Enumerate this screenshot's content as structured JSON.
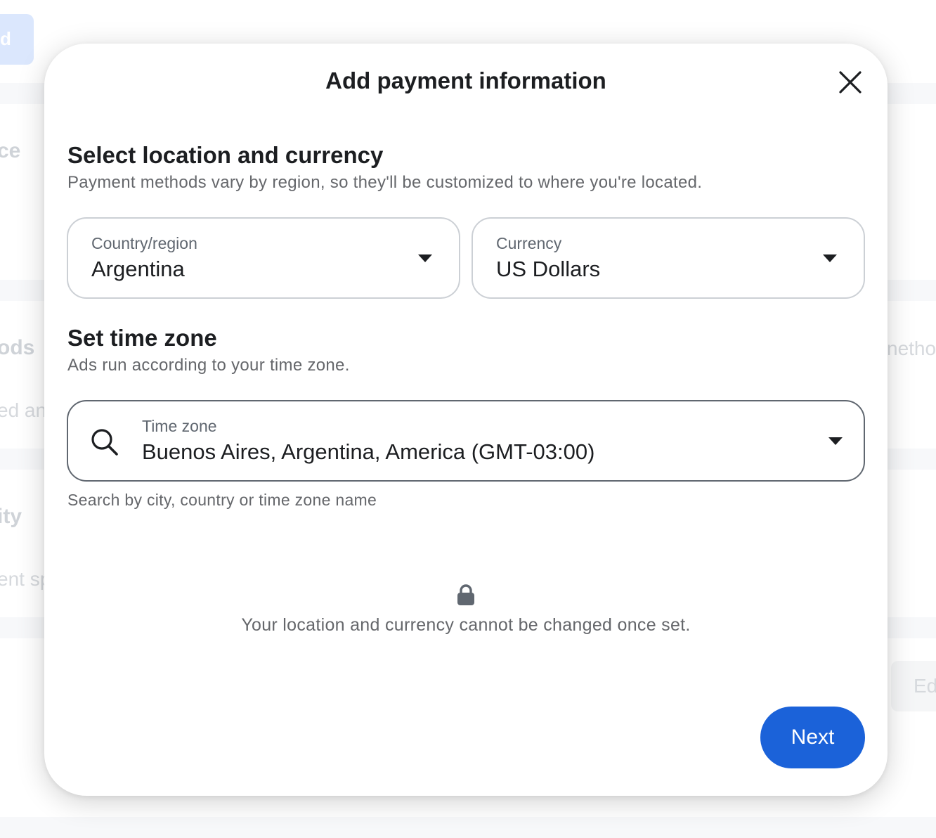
{
  "background": {
    "button_fragment": "d",
    "text_fragments": [
      "ce",
      "ods",
      "ed any",
      "ity",
      "ent sp",
      "netho",
      "Ed"
    ]
  },
  "modal": {
    "title": "Add payment information",
    "location_section": {
      "title": "Select location and currency",
      "subtitle": "Payment methods vary by region, so they'll be customized to where you're located."
    },
    "country": {
      "label": "Country/region",
      "value": "Argentina"
    },
    "currency": {
      "label": "Currency",
      "value": "US Dollars"
    },
    "timezone_section": {
      "title": "Set time zone",
      "subtitle": "Ads run according to your time zone."
    },
    "timezone": {
      "label": "Time zone",
      "value": "Buenos Aires, Argentina, America (GMT-03:00)",
      "helper": "Search by city, country or time zone name"
    },
    "lock_note": "Your location and currency cannot be changed once set.",
    "next_label": "Next"
  },
  "colors": {
    "primary": "#1b62d9",
    "text": "#1c1e21",
    "secondary_text": "#65676b"
  },
  "icons": [
    "close-icon",
    "search-icon",
    "lock-icon",
    "chevron-down-icon"
  ]
}
